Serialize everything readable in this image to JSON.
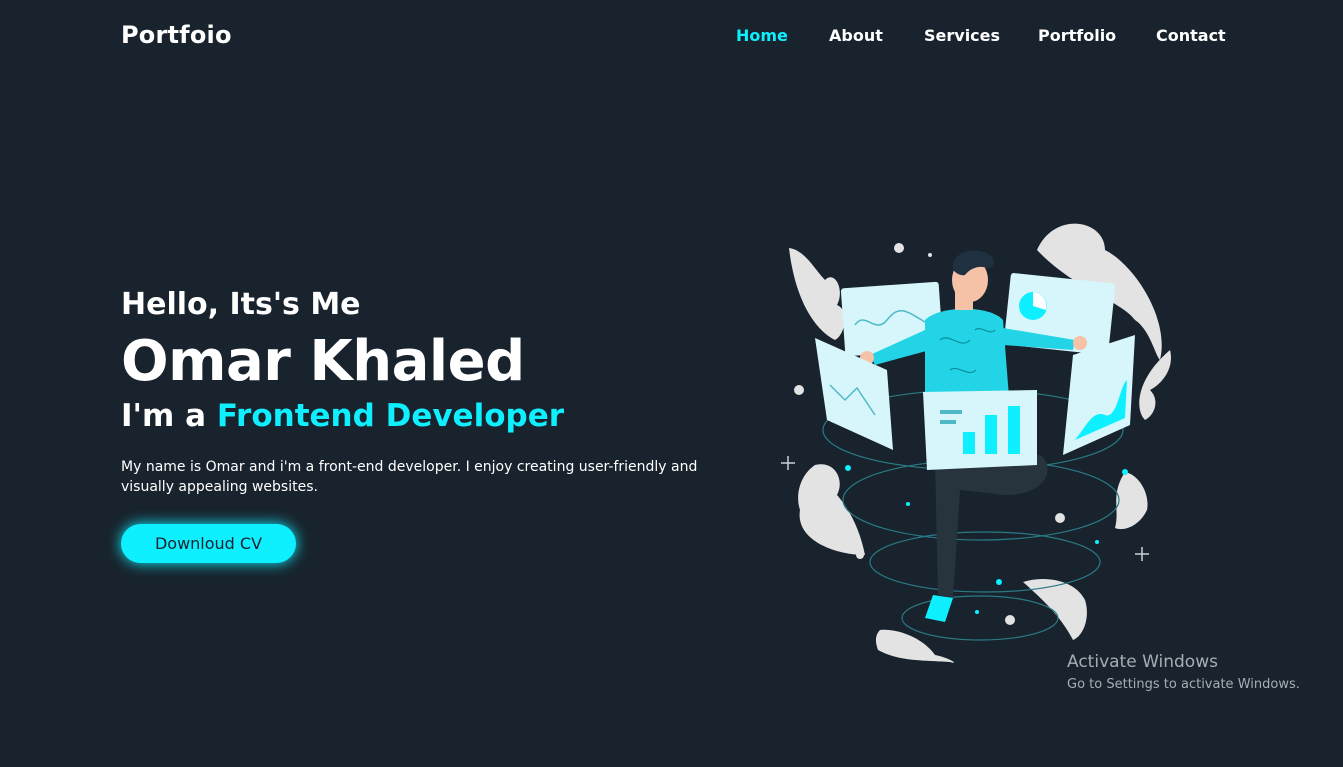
{
  "header": {
    "logo": "Portfoio",
    "nav": [
      {
        "label": "Home",
        "active": true
      },
      {
        "label": "About",
        "active": false
      },
      {
        "label": "Services",
        "active": false
      },
      {
        "label": "Portfolio",
        "active": false
      },
      {
        "label": "Contact",
        "active": false
      }
    ]
  },
  "hero": {
    "greeting": "Hello, Its's Me",
    "name": "Omar Khaled",
    "role_prefix": "I'm a ",
    "role_highlight": "Frontend Developer",
    "description": "My name is Omar and i'm a front-end developer. I enjoy creating user-friendly and visually appealing websites.",
    "cv_button": "Downloud CV"
  },
  "illustration": {
    "icon": "developer-with-screens-illustration"
  },
  "os_watermark": {
    "title": "Activate Windows",
    "subtitle": "Go to Settings to activate Windows."
  },
  "colors": {
    "background": "#18232d",
    "accent": "#0ef0ff",
    "text": "#ffffff"
  }
}
